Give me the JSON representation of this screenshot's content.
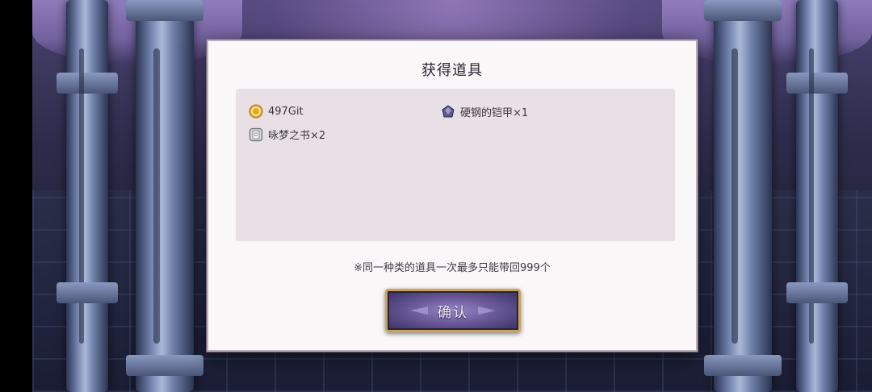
{
  "dialog": {
    "title": "获得道具",
    "rewards": [
      {
        "icon": "gold-coin-icon",
        "label": "497Git"
      },
      {
        "icon": "armor-gem-icon",
        "label": "硬钢的铠甲×1"
      },
      {
        "icon": "spellbook-icon",
        "label": "咏梦之书×2"
      }
    ],
    "note": "※同一种类的道具一次最多只能带回999个",
    "confirm_label": "确认"
  },
  "colors": {
    "button_border": "#c9a45a",
    "button_fill": "#6a5a9a",
    "panel_bg": "#e8e0e5"
  }
}
